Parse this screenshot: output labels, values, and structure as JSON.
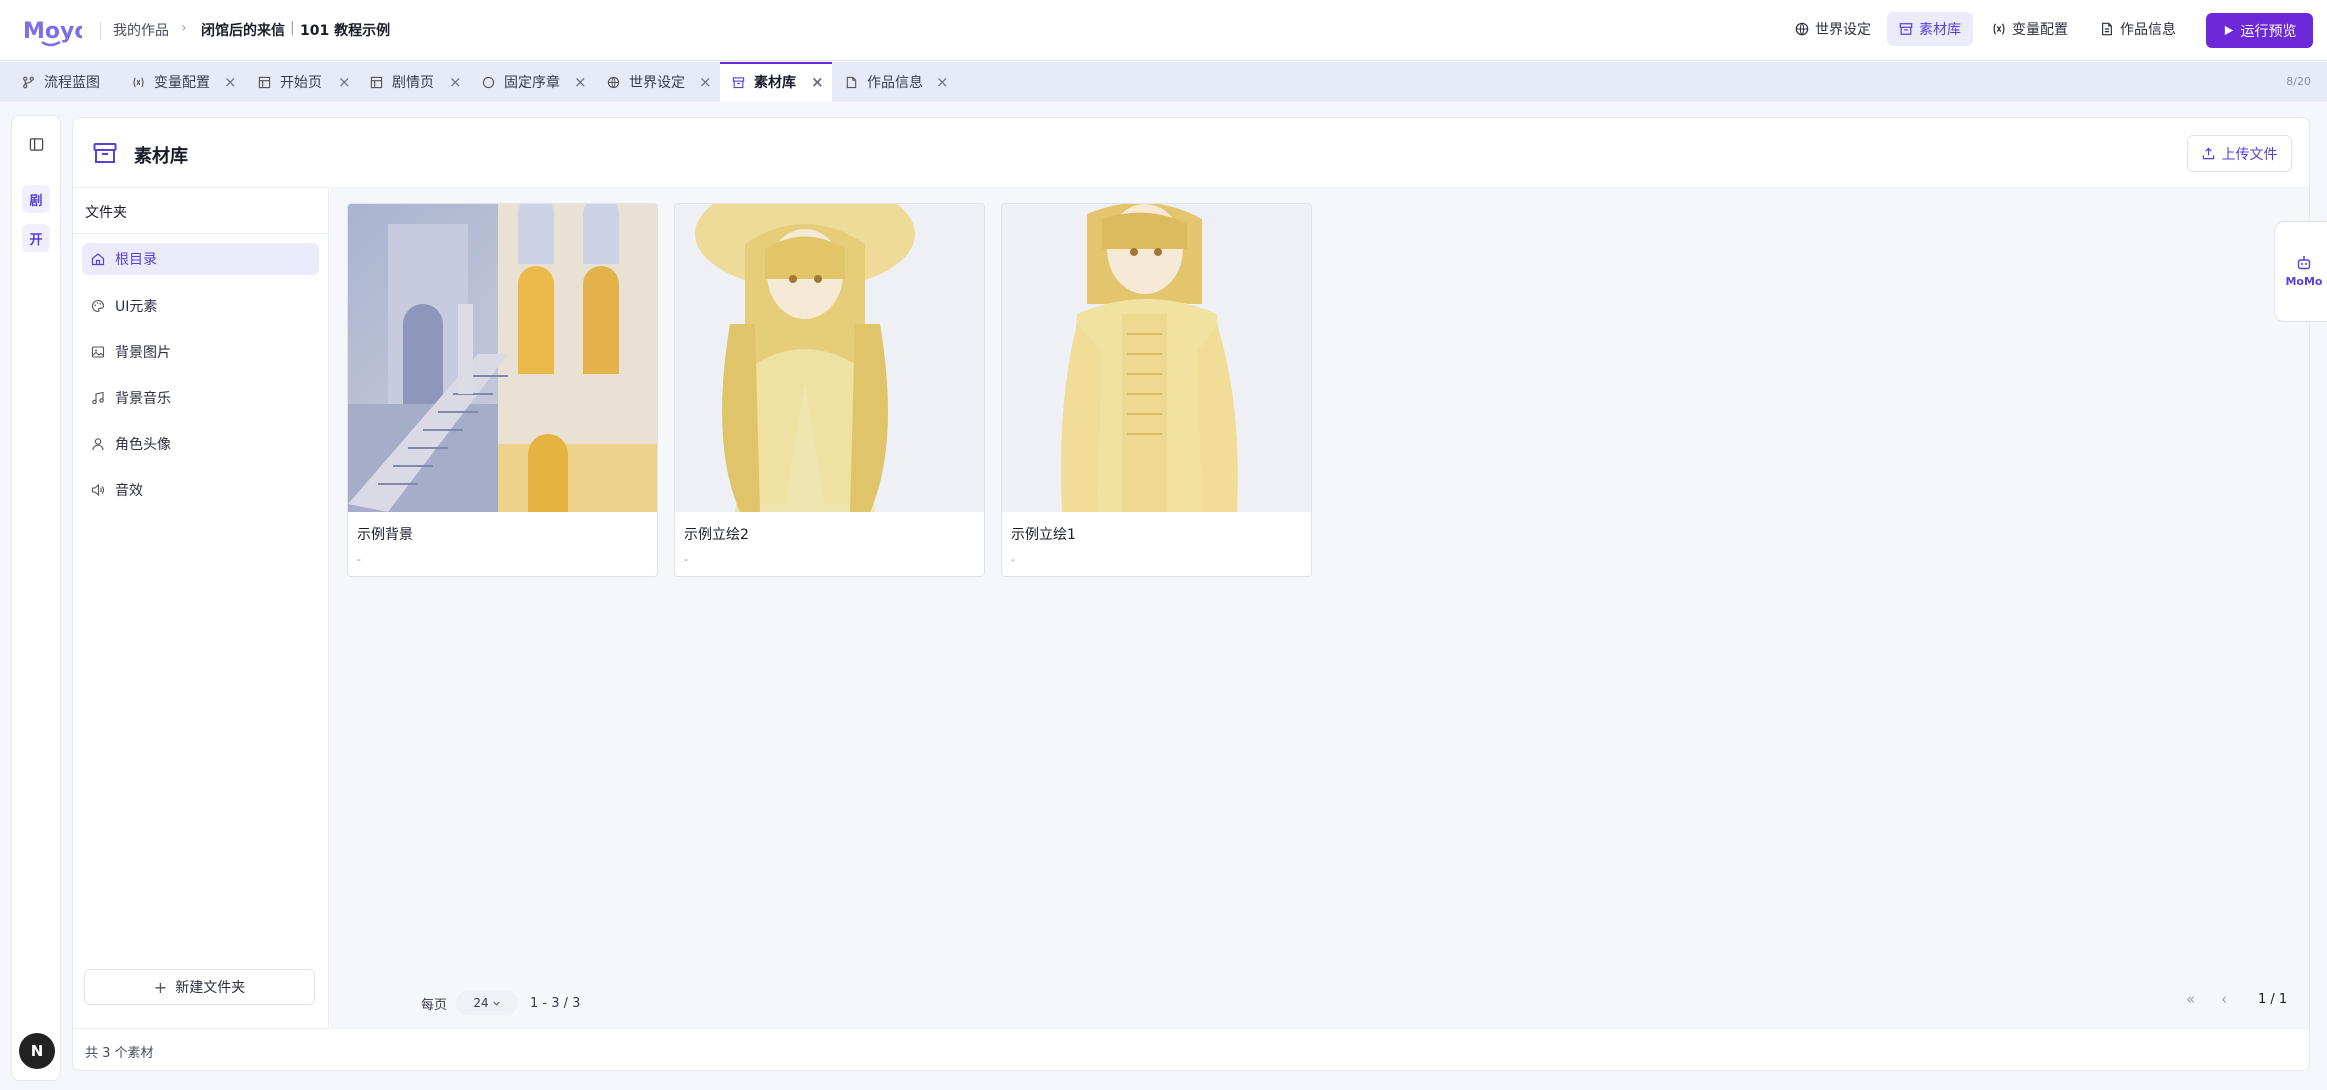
{
  "header": {
    "logo_text": "Moyo",
    "breadcrumb": {
      "root": "我的作品",
      "project": "闭馆后的来信",
      "divider": "|",
      "example": "101 教程示例"
    },
    "nav": [
      {
        "label": "世界设定",
        "icon": "globe-icon"
      },
      {
        "label": "素材库",
        "icon": "archive-icon",
        "active": true
      },
      {
        "label": "变量配置",
        "icon": "variable-icon"
      },
      {
        "label": "作品信息",
        "icon": "document-icon"
      }
    ],
    "run_label": "运行预览"
  },
  "tabs": {
    "items": [
      {
        "label": "流程蓝图",
        "icon": "branch-icon",
        "closable": false
      },
      {
        "label": "变量配置",
        "icon": "variable-icon",
        "closable": true,
        "close": "×"
      },
      {
        "label": "开始页",
        "icon": "layout-icon",
        "closable": true,
        "close": "×"
      },
      {
        "label": "剧情页",
        "icon": "layout-icon",
        "closable": true,
        "close": "×"
      },
      {
        "label": "固定序章",
        "icon": "circle-icon",
        "closable": true,
        "close": "×"
      },
      {
        "label": "世界设定",
        "icon": "globe-icon",
        "closable": true,
        "close": "×"
      },
      {
        "label": "素材库",
        "icon": "archive-icon",
        "closable": true,
        "active": true,
        "close": "×"
      },
      {
        "label": "作品信息",
        "icon": "document-icon",
        "closable": true,
        "close": "×"
      }
    ],
    "count": "8/20"
  },
  "mini_sidebar": {
    "items": [
      "剧",
      "开"
    ],
    "avatar": "N"
  },
  "library": {
    "title": "素材库",
    "upload_label": "上传文件",
    "folders_title": "文件夹",
    "folders": [
      {
        "label": "根目录",
        "icon": "home-icon",
        "active": true
      },
      {
        "label": "UI元素",
        "icon": "palette-icon"
      },
      {
        "label": "背景图片",
        "icon": "image-icon"
      },
      {
        "label": "背景音乐",
        "icon": "music-icon"
      },
      {
        "label": "角色头像",
        "icon": "user-icon"
      },
      {
        "label": "音效",
        "icon": "speaker-icon"
      }
    ],
    "new_folder_label": "新建文件夹",
    "assets": [
      {
        "name": "示例背景",
        "sub": "-",
        "kind": "background"
      },
      {
        "name": "示例立绘2",
        "sub": "-",
        "kind": "character-hat"
      },
      {
        "name": "示例立绘1",
        "sub": "-",
        "kind": "character"
      }
    ],
    "pagination": {
      "per_page_label": "每页",
      "per_page": "24",
      "range": "1 - 3 / 3",
      "page": "1 / 1"
    },
    "footer": "共 3 个素材"
  },
  "assistant": {
    "label": "MoMo"
  },
  "colors": {
    "accent": "#6d28d9",
    "accent_soft": "#ecebfb",
    "tab_bar": "#e6ebf7",
    "background": "#f4f6fb"
  }
}
